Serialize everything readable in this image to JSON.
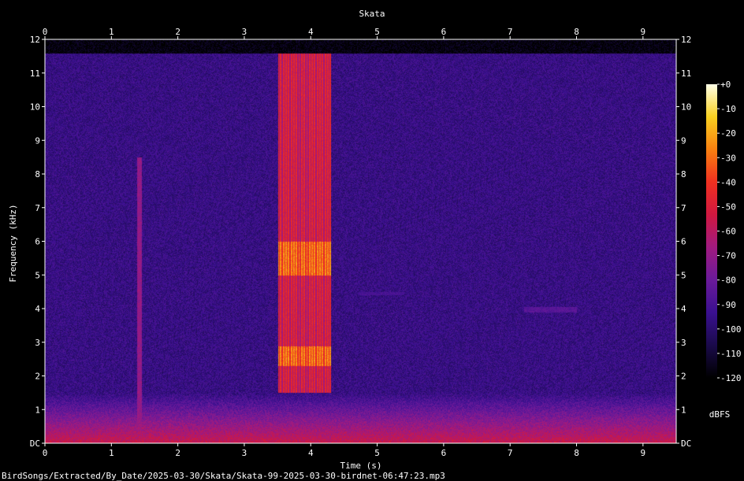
{
  "chart_data": {
    "type": "heatmap",
    "title": "Skata",
    "xlabel": "Time (s)",
    "ylabel": "Frequency (kHz)",
    "xlim": [
      0,
      9.5
    ],
    "ylim": [
      0,
      12
    ],
    "x_ticks": [
      "0",
      "1",
      "2",
      "3",
      "4",
      "5",
      "6",
      "7",
      "8",
      "9"
    ],
    "y_ticks": [
      "DC",
      "1",
      "2",
      "3",
      "4",
      "5",
      "6",
      "7",
      "8",
      "9",
      "10",
      "11",
      "12"
    ],
    "colorbar": {
      "label": "dBFS",
      "range": [
        -120,
        0
      ],
      "ticks": [
        "+0",
        "-10",
        "-20",
        "-30",
        "-40",
        "-50",
        "-60",
        "-70",
        "-80",
        "-90",
        "-100",
        "-110",
        "-120"
      ],
      "colormap": [
        "#000000",
        "#1a0a4a",
        "#3a1090",
        "#6a1a9a",
        "#a01a80",
        "#d01840",
        "#f03020",
        "#f88010",
        "#f8d020",
        "#ffffe8"
      ]
    },
    "footer": "BirdSongs/Extracted/By_Date/2025-03-30/Skata/Skata-99-2025-03-30-birdnet-06:47:23.mp3",
    "background_level_db": -95,
    "low_freq_energy": {
      "below_khz": 1.5,
      "level_db": -55
    },
    "events": [
      {
        "label": "call burst",
        "t_start": 3.5,
        "t_end": 4.3,
        "f_low": 1.5,
        "f_high": 11.6,
        "peak_db": -20,
        "peak_bands_khz": [
          [
            2.3,
            2.9
          ],
          [
            5.0,
            6.0
          ]
        ]
      },
      {
        "label": "transient",
        "t_start": 1.38,
        "t_end": 1.45,
        "f_low": 0,
        "f_high": 8.5,
        "peak_db": -45
      },
      {
        "label": "tone",
        "t_start": 4.7,
        "t_end": 5.4,
        "f_low": 4.4,
        "f_high": 4.5,
        "peak_db": -65
      },
      {
        "label": "tone",
        "t_start": 7.2,
        "t_end": 8.0,
        "f_low": 3.9,
        "f_high": 4.05,
        "peak_db": -60
      }
    ]
  }
}
